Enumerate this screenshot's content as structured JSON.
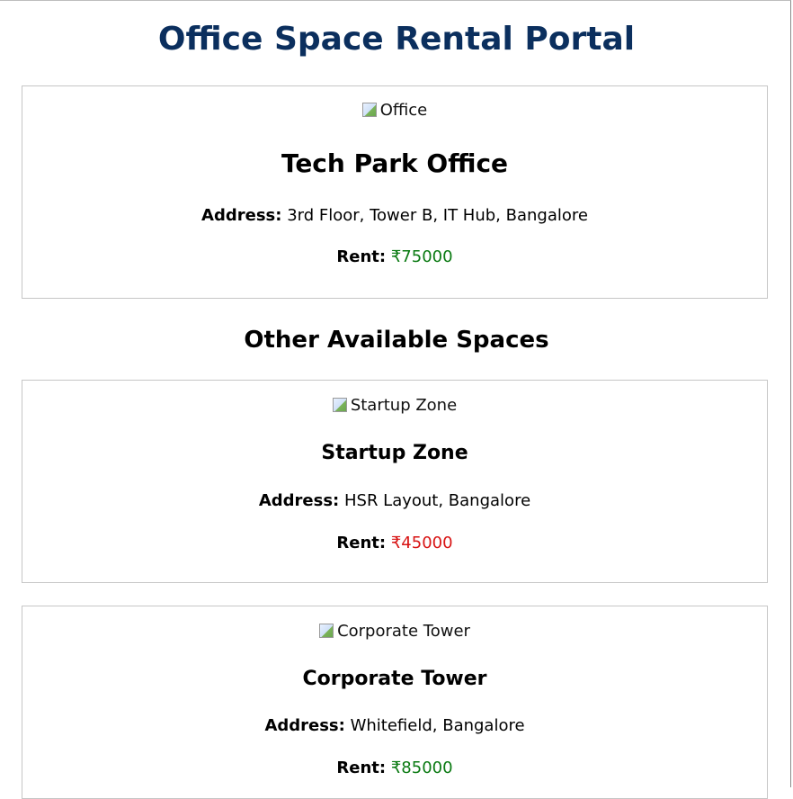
{
  "header": {
    "title": "Office Space Rental Portal"
  },
  "featured": {
    "image_alt": "Office",
    "name": "Tech Park Office",
    "address_label": "Address:",
    "address": "3rd Floor, Tower B, IT Hub, Bangalore",
    "rent_label": "Rent:",
    "rent": "₹75000",
    "rent_color": "#0a7a12"
  },
  "section": {
    "title": "Other Available Spaces"
  },
  "spaces": [
    {
      "image_alt": "Startup Zone",
      "name": "Startup Zone",
      "address_label": "Address:",
      "address": "HSR Layout, Bangalore",
      "rent_label": "Rent:",
      "rent": "₹45000",
      "rent_color": "#d81414"
    },
    {
      "image_alt": "Corporate Tower",
      "name": "Corporate Tower",
      "address_label": "Address:",
      "address": "Whitefield, Bangalore",
      "rent_label": "Rent:",
      "rent": "₹85000",
      "rent_color": "#0a7a12"
    }
  ],
  "icons": {
    "broken_image": "broken-image-icon"
  }
}
